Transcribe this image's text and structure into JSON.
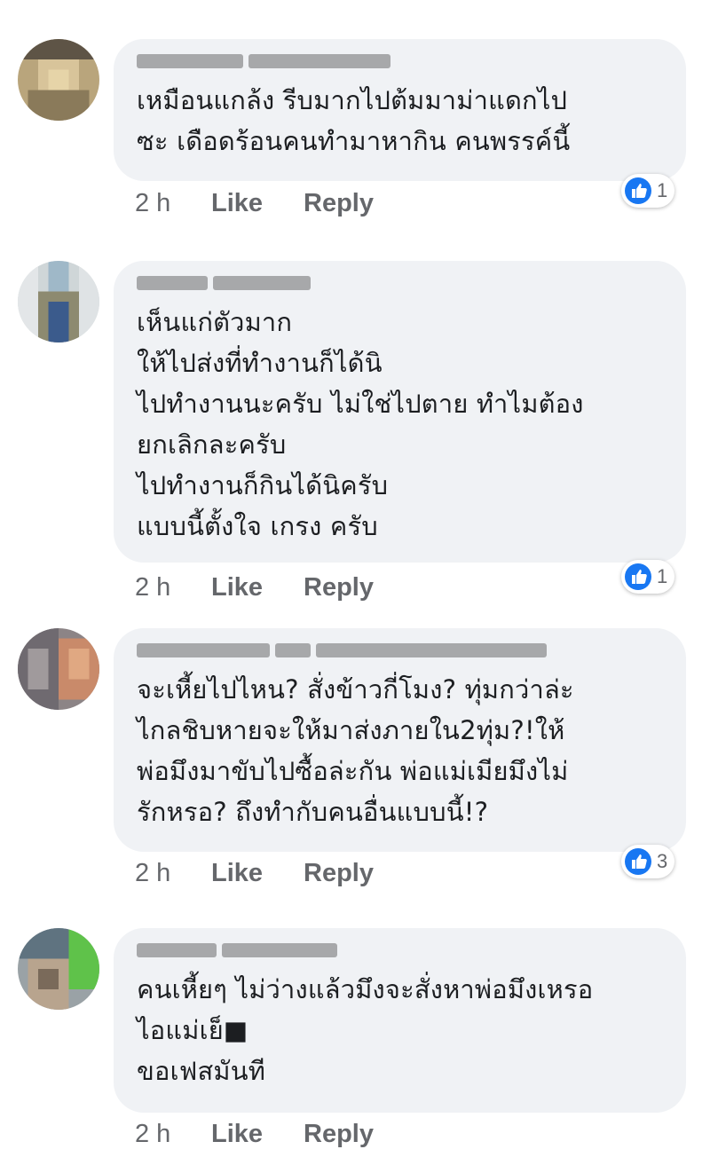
{
  "comments": [
    {
      "text": "เหมือนแกล้ง รีบมากไปต้มมาม่าแดกไป\nซะ เดือดร้อนคนทำมาหากิน คนพรรค์นี้",
      "time": "2 h",
      "like_label": "Like",
      "reply_label": "Reply",
      "reaction_count": "1"
    },
    {
      "text": "เห็นแก่ตัวมาก\nให้ไปส่งที่ทำงานก็ได้นิ\nไปทำงานนะครับ ไม่ใช่ไปตาย ทำไมต้อง\nยกเลิกละครับ\nไปทำงานก็กินได้นิครับ\nแบบนี้ตั้งใจ เกรง ครับ",
      "time": "2 h",
      "like_label": "Like",
      "reply_label": "Reply",
      "reaction_count": "1"
    },
    {
      "text": "จะเหี้ยไปไหน? สั่งข้าวกี่โมง? ทุ่มกว่าล่ะ\nไกลชิบหายจะให้มาส่งภายใน2ทุ่ม?!ให้\nพ่อมึงมาขับไปซื้อล่ะกัน พ่อแม่เมียมึงไม่\nรักหรอ? ถึงทำกับคนอื่นแบบนี้!?",
      "time": "2 h",
      "like_label": "Like",
      "reply_label": "Reply",
      "reaction_count": "3"
    },
    {
      "text": "คนเหี้ยๆ ไม่ว่างแล้วมึงจะสั่งหาพ่อมึงเหรอ\nไอแม่เย็■\nขอเฟสมันที",
      "time": "2 h",
      "like_label": "Like",
      "reply_label": "Reply"
    }
  ],
  "colors": {
    "bubble": "#f0f2f5",
    "meta_text": "#65676b",
    "like_blue": "#1877f2"
  },
  "icons": {
    "reaction": "thumbs-up-icon",
    "avatar": "blurred-avatar"
  }
}
